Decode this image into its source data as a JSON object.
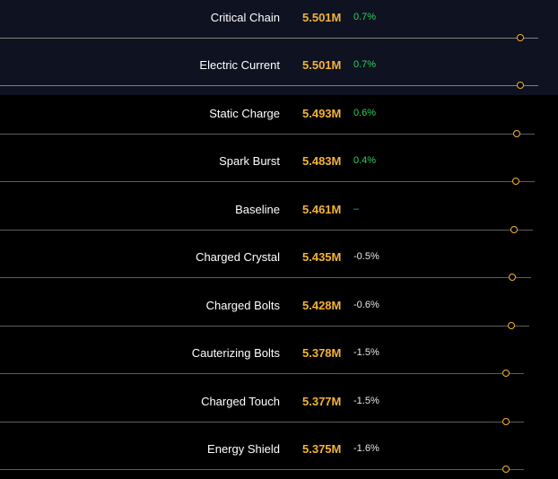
{
  "rows": [
    {
      "name": "Critical Chain",
      "value": "5.501M",
      "pct": "0.7%",
      "trend": "pos",
      "selected": true
    },
    {
      "name": "Electric Current",
      "value": "5.501M",
      "pct": "0.7%",
      "trend": "pos",
      "selected": true
    },
    {
      "name": "Static Charge",
      "value": "5.493M",
      "pct": "0.6%",
      "trend": "pos",
      "selected": false
    },
    {
      "name": "Spark Burst",
      "value": "5.483M",
      "pct": "0.4%",
      "trend": "pos",
      "selected": false
    },
    {
      "name": "Baseline",
      "value": "5.461M",
      "pct": "–",
      "trend": "neu",
      "selected": false
    },
    {
      "name": "Charged Crystal",
      "value": "5.435M",
      "pct": "-0.5%",
      "trend": "neg",
      "selected": false
    },
    {
      "name": "Charged Bolts",
      "value": "5.428M",
      "pct": "-0.6%",
      "trend": "neg",
      "selected": false
    },
    {
      "name": "Cauterizing Bolts",
      "value": "5.378M",
      "pct": "-1.5%",
      "trend": "neg",
      "selected": false
    },
    {
      "name": "Charged Touch",
      "value": "5.377M",
      "pct": "-1.5%",
      "trend": "neg",
      "selected": false
    },
    {
      "name": "Energy Shield",
      "value": "5.375M",
      "pct": "-1.6%",
      "trend": "neg",
      "selected": false
    }
  ],
  "colors": {
    "value": "#f5b335",
    "positive": "#2ed158",
    "negative": "#e8e8e8",
    "neutral": "#3aa0c8",
    "highlight_bg": "#0f1220"
  }
}
